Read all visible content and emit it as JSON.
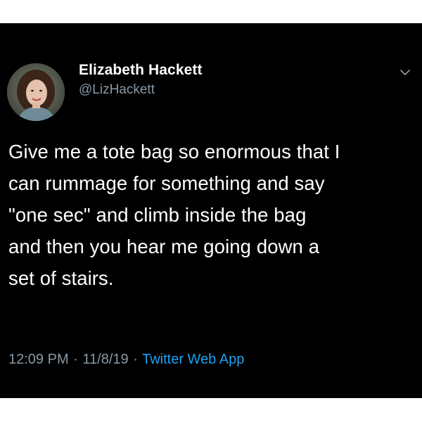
{
  "tweet": {
    "author": {
      "display_name": "Elizabeth Hackett",
      "handle": "@LizHackett",
      "avatar_icon": "profile-photo"
    },
    "menu_icon": "chevron-down-icon",
    "text_lines": [
      "Give me a tote bag so enormous that I",
      "can rummage for something and say",
      "\"one sec\" and climb inside the bag",
      "and then you hear me going down a",
      "set of stairs."
    ],
    "meta": {
      "time": "12:09 PM",
      "separator": "·",
      "date": "11/8/19",
      "source": "Twitter Web App"
    }
  },
  "colors": {
    "background": "#000000",
    "text": "#ffffff",
    "secondary_text": "#8899a6",
    "link": "#1da1f2"
  }
}
